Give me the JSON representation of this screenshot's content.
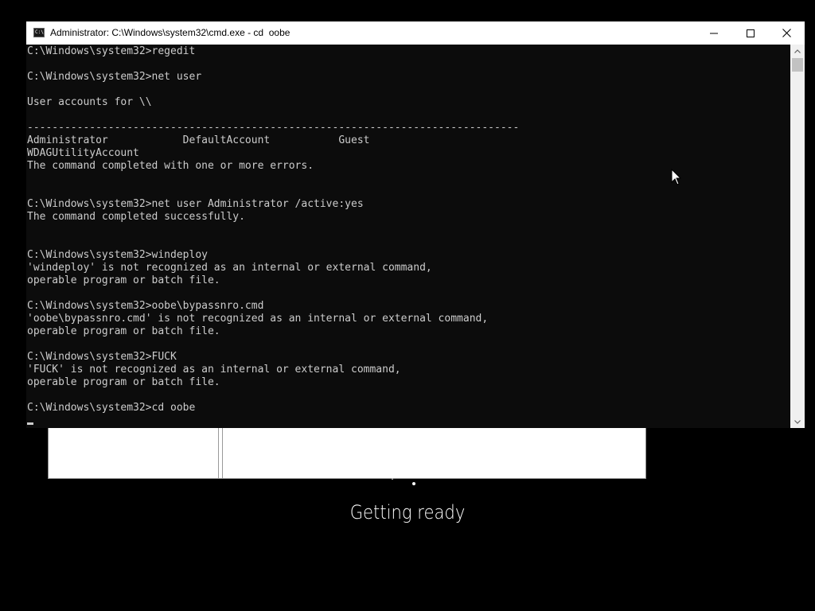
{
  "oobe": {
    "status_text": "Getting ready"
  },
  "cmd": {
    "title": "Administrator: C:\\Windows\\system32\\cmd.exe - cd  oobe",
    "icon": "cmd-icon",
    "icon_glyph": "C:\\",
    "controls": {
      "minimize_icon": "minimize-icon",
      "maximize_icon": "maximize-icon",
      "close_icon": "close-icon"
    },
    "colors": {
      "console_bg": "#0c0c0c",
      "console_fg": "#cccccc",
      "titlebar_bg": "#ffffff"
    },
    "lines": [
      "C:\\Windows\\system32>regedit",
      "",
      "C:\\Windows\\system32>net user",
      "",
      "User accounts for \\\\",
      "",
      "-------------------------------------------------------------------------------",
      "Administrator            DefaultAccount           Guest",
      "WDAGUtilityAccount",
      "The command completed with one or more errors.",
      "",
      "",
      "C:\\Windows\\system32>net user Administrator /active:yes",
      "The command completed successfully.",
      "",
      "",
      "C:\\Windows\\system32>windeploy",
      "'windeploy' is not recognized as an internal or external command,",
      "operable program or batch file.",
      "",
      "C:\\Windows\\system32>oobe\\bypassnro.cmd",
      "'oobe\\bypassnro.cmd' is not recognized as an internal or external command,",
      "operable program or batch file.",
      "",
      "C:\\Windows\\system32>FUCK",
      "'FUCK' is not recognized as an internal or external command,",
      "operable program or batch file.",
      "",
      "C:\\Windows\\system32>cd oobe"
    ]
  },
  "scrollbar": {
    "up_icon": "scroll-up-arrow-icon",
    "down_icon": "scroll-down-arrow-icon"
  },
  "pointer": {
    "icon": "mouse-pointer-icon"
  }
}
